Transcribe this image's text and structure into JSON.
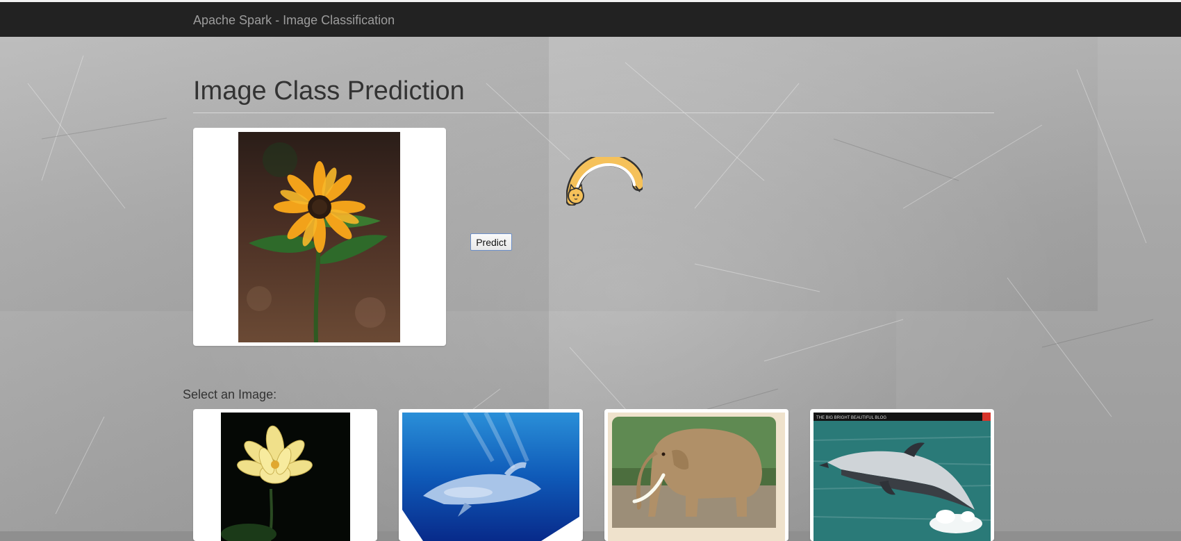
{
  "navbar": {
    "brand": "Apache Spark - Image Classification"
  },
  "main": {
    "title": "Image Class Prediction",
    "predict_label": "Predict",
    "select_label": "Select an Image:",
    "preview_image": "sunflower-photo",
    "thumbnails": [
      {
        "image": "yellow-lotus-photo"
      },
      {
        "image": "whale-underwater-photo"
      },
      {
        "image": "elephant-photo"
      },
      {
        "image": "dolphin-jumping-photo",
        "caption_text": "THE BIG BRIGHT BEAUTIFUL BLOG"
      }
    ]
  },
  "loading_indicator": "cat-loading-icon",
  "colors": {
    "navbar_bg": "#222222",
    "brand_text": "#9d9d9d",
    "button_border": "#6c8fc9"
  }
}
